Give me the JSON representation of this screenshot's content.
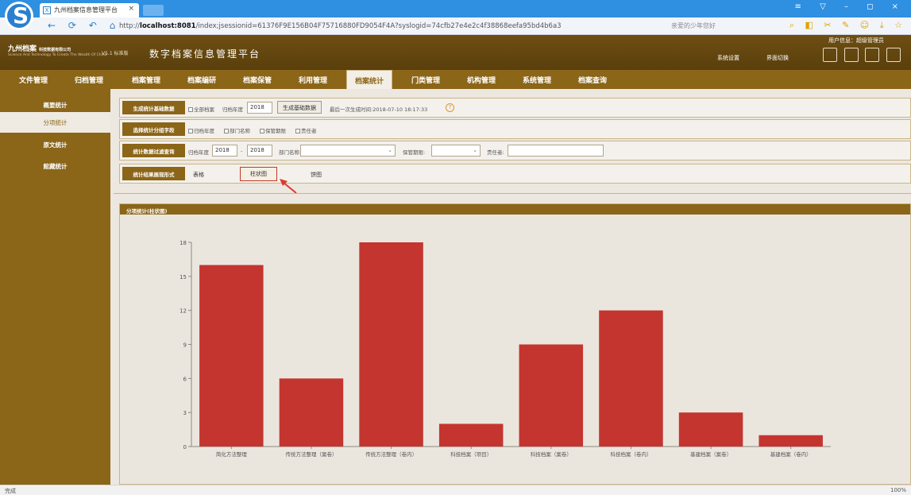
{
  "browser": {
    "tab_title": "九州档案信息管理平台",
    "tab_close": "×",
    "url_prefix": "http://",
    "url_host": "localhost:8081",
    "url_rest": "/index;jsessionid=61376F9E156B04F75716880FD9054F4A?syslogid=74cfb27e4e2c4f38868eefa95bd4b6a3",
    "address_hint": "亲爱的少年您好",
    "window_controls": "≡ ▽ – ◻ ×",
    "nav_buttons": "← ⟳ ↶ ⌂"
  },
  "header": {
    "brand": "九州档案",
    "brand_sub": "科技数据有限公司",
    "slogan": "Science And Technology To Create The Wealth Of China",
    "version": "V5.1 标准版",
    "title": "数字档案信息管理平台",
    "user_info": "用户信息：超级管理员",
    "system_settings": "系统设置",
    "switch_ui": "界面切换"
  },
  "nav": {
    "items": [
      "文件管理",
      "归档管理",
      "档案管理",
      "档案编研",
      "档案保管",
      "利用管理",
      "档案统计",
      "门类管理",
      "机构管理",
      "系统管理",
      "档案查询"
    ],
    "active_index": 6
  },
  "sidebar": {
    "items": [
      "概要统计",
      "分项统计",
      "原文统计",
      "館藏统计"
    ],
    "active_index": 1
  },
  "form": {
    "row1": {
      "label": "生成统计基础数据",
      "all_archives": "全部档案",
      "archive_year_label": "归档年度",
      "archive_year_value": "2018",
      "generate_button": "生成基础数据",
      "last_generated": "最后一次生成时间:2018-07-10 18:17:33",
      "help": "?"
    },
    "row2": {
      "label": "选择统计分组字段",
      "options": [
        "归档年度",
        "部门名称",
        "保管期限",
        "责任者"
      ]
    },
    "row3": {
      "label": "统计数据过滤查询",
      "year_label": "归档年度",
      "year_from": "2018",
      "year_sep": "-",
      "year_to": "2018",
      "dept_label": "部门名称:",
      "dept_value": "",
      "retention_label": "保管期限:",
      "retention_value": "",
      "responsible_label": "责任者:",
      "responsible_value": "",
      "dropdown_arrow": "⌄"
    },
    "row4": {
      "label": "统计结果展现形式",
      "options": [
        "表格",
        "柱状图",
        "饼图"
      ],
      "selected_index": 1
    }
  },
  "chart_panel": {
    "title": "分项统计(柱状图)"
  },
  "chart_data": {
    "type": "bar",
    "categories": [
      "简化方法整理",
      "传统方法整理（案卷）",
      "传统方法整理（卷内）",
      "科技档案（项目）",
      "科技档案（案卷）",
      "科技档案（卷内）",
      "基建档案（案卷）",
      "基建档案（卷内）"
    ],
    "values": [
      16,
      6,
      18,
      2,
      9,
      12,
      3,
      1
    ],
    "yticks": [
      0,
      3,
      6,
      9,
      12,
      15,
      18
    ],
    "ylim": [
      0,
      18
    ],
    "bar_color": "#c43530",
    "title": "",
    "xlabel": "",
    "ylabel": ""
  },
  "status": {
    "left": "完成",
    "right": "100%"
  },
  "colors": {
    "header_brown": "#6e4e13",
    "nav_brown": "#8b6518",
    "browser_blue": "#2f8fe0"
  }
}
